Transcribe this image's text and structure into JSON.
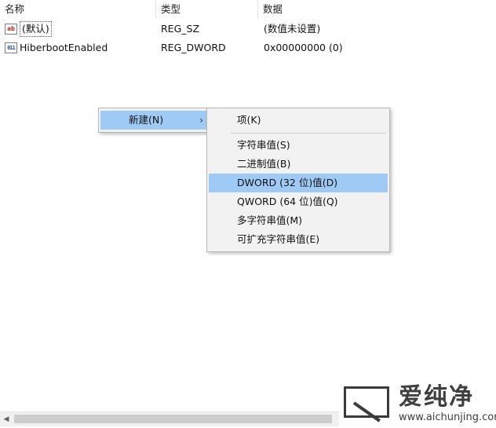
{
  "columns": [
    "名称",
    "类型",
    "数据"
  ],
  "rows": [
    {
      "icon": "string-value-icon",
      "glyph": "ab",
      "name": "(默认)",
      "type": "REG_SZ",
      "data": "(数值未设置)"
    },
    {
      "icon": "binary-value-icon",
      "glyph": "011",
      "name": "HiberbootEnabled",
      "type": "REG_DWORD",
      "data": "0x00000000 (0)"
    }
  ],
  "context_menu": {
    "item": "新建(N)",
    "arrow": "›"
  },
  "submenu": {
    "items": [
      "项(K)",
      "字符串值(S)",
      "二进制值(B)",
      "DWORD (32 位)值(D)",
      "QWORD (64 位)值(Q)",
      "多字符串值(M)",
      "可扩充字符串值(E)"
    ],
    "highlighted": "DWORD (32 位)值(D)"
  },
  "scrollbar": {
    "left_arrow": "◀"
  },
  "watermark": {
    "title": "爱纯净",
    "url": "www.aichunjing.com"
  },
  "colors": {
    "highlight": "#9fcaf5",
    "menu_bg": "#f2f2f2",
    "background": "#ffffff"
  }
}
